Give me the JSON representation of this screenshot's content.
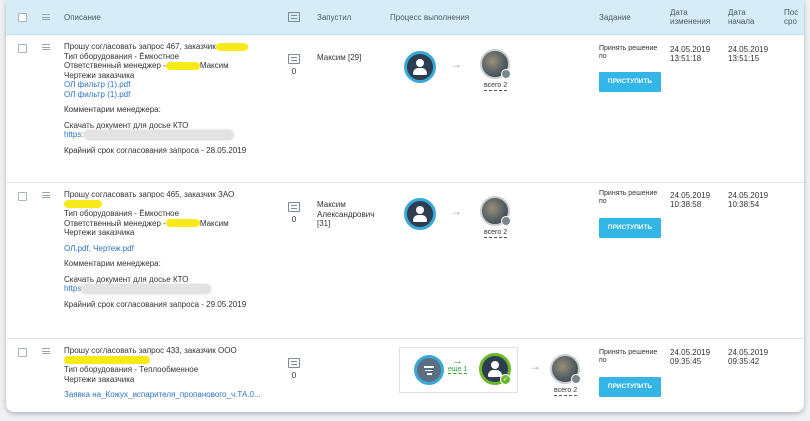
{
  "header": {
    "description": "Описание",
    "launched": "Запустил",
    "process": "Процесс выполнения",
    "task": "Задание",
    "changed_date": "Дата\nизменения",
    "start_date": "Дата\nначала",
    "last_col": "Пос\nсро"
  },
  "rows": [
    {
      "title": "Прошу согласовать запрос 467, заказчик",
      "equip": "Тип оборудования - Ёмкостное",
      "manager_prefix": "Ответственный менеджер -",
      "manager_name": "Максим",
      "drawings": "Чертежи заказчика",
      "files": [
        "ОЛ фильтр (1).pdf",
        "ОЛ фильтр (1).pdf"
      ],
      "comments_label": "Комментарии менеджера:",
      "download": "Скачать документ для досье КТО",
      "link_prefix": "https:",
      "deadline": "Крайний срок согласования запроса - 28.05.2019",
      "comment_count": "0",
      "launched_by": "Максим [29]",
      "total": "всего 2",
      "task": "Принять решение по",
      "button": "ПРИСТУПИТЬ",
      "changed": "24.05.2019\n13:51:18",
      "started": "24.05.2019\n13:51:15"
    },
    {
      "title": "Прошу согласовать запрос 465, заказчик ЗАО",
      "equip": "Тип оборудования - Ёмкостное",
      "manager_prefix": "Ответственный менеджер -",
      "manager_name": "Максим",
      "drawings": "Чертежи заказчика",
      "files": [
        "ОЛ.pdf, Чертеж.pdf"
      ],
      "comments_label": "Комментарии менеджера:",
      "download": "Скачать документ для досье КТО",
      "link_prefix": "https",
      "deadline": "Крайний срок согласования запроса - 29.05.2019",
      "comment_count": "0",
      "launched_by": "Максим\nАлександрович\n[31]",
      "total": "всего 2",
      "task": "Принять решение по",
      "button": "ПРИСТУПИТЬ",
      "changed": "24.05.2019\n10:38:58",
      "started": "24.05.2019\n10:38:54"
    },
    {
      "title": "Прошу согласовать запрос 433, заказчик ООО",
      "equip": "Тип оборудования - Теплообменное",
      "drawings": "Чертежи заказчика",
      "files": [
        "Заявка на_Кожух_испарителя_пропанового_ч.ТА.0..."
      ],
      "comment_count": "0",
      "more": "еще 1",
      "total": "всего 2",
      "task": "Принять решение по",
      "button": "ПРИСТУПИТЬ",
      "changed": "24.05.2019\n09:35:45",
      "started": "24.05.2019\n09:35:42"
    }
  ],
  "icons": {
    "comment": "comment-icon",
    "user": "user-avatar-icon",
    "group": "group-photo-icon",
    "filter": "filter-icon",
    "arrow": "arrow-right-icon"
  },
  "colors": {
    "header_bg": "#d6edf8",
    "button": "#33b5e8",
    "avatar_ring": "#3aa8d8",
    "highlight": "#f7ea1a",
    "link": "#2b74c4"
  }
}
